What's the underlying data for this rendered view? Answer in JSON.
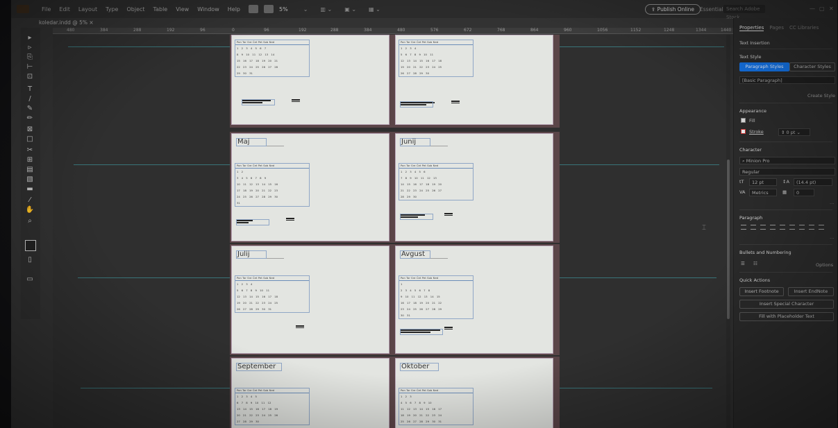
{
  "menubar": {
    "items": [
      "File",
      "Edit",
      "Layout",
      "Type",
      "Object",
      "Table",
      "View",
      "Window",
      "Help"
    ],
    "zoom": "5%",
    "publish_label": "Publish Online",
    "workspace": "Essentials",
    "search_placeholder": "Search Adobe Stock"
  },
  "document": {
    "tab_label": "koledar.indd @ 5%"
  },
  "ruler": {
    "ticks": [
      "480",
      "384",
      "288",
      "192",
      "96",
      "0",
      "96",
      "192",
      "288",
      "384",
      "480",
      "576",
      "672",
      "768",
      "864",
      "960",
      "1056",
      "1152",
      "1248",
      "1344",
      "1440"
    ]
  },
  "calendar": {
    "weekday_header": "Pon Tor Sre Čet Pet Sob Ned",
    "spreads": [
      {
        "left": {
          "month": "",
          "rows": [
            "1 2 3 4 5 6 7",
            "8 9 10 11 12 13 14",
            "15 16 17 18 19 20 21",
            "22 23 24 25 26 27 28",
            "29 30 31"
          ]
        },
        "right": {
          "month": "",
          "rows": [
            "1 2 3 4",
            "5 6 7 8 9 10 11",
            "12 13 14 15 16 17 18",
            "19 20 21 22 23 24 25",
            "26 27 28 29 30"
          ]
        }
      },
      {
        "left": {
          "month": "Maj",
          "rows": [
            "1 2",
            "3 4 5 6 7 8 9",
            "10 11 12 13 14 15 16",
            "17 18 19 20 21 22 23",
            "24 25 26 27 28 29 30",
            "31"
          ]
        },
        "right": {
          "month": "Junij",
          "rows": [
            "1 2 3 4 5 6",
            "7 8 9 10 11 12 13",
            "14 15 16 17 18 19 20",
            "21 22 23 24 25 26 27",
            "28 29 30"
          ]
        }
      },
      {
        "left": {
          "month": "Julij",
          "rows": [
            "1 2 3 4",
            "5 6 7 8 9 10 11",
            "12 13 14 15 16 17 18",
            "19 20 21 22 23 24 25",
            "26 27 28 29 30 31"
          ]
        },
        "right": {
          "month": "Avgust",
          "rows": [
            "1",
            "2 3 4 5 6 7 8",
            "9 10 11 12 13 14 15",
            "16 17 18 19 20 21 22",
            "23 24 25 26 27 28 29",
            "30 31"
          ]
        }
      },
      {
        "left": {
          "month": "September",
          "rows": [
            "1 2 3 4 5",
            "6 7 8 9 10 11 12",
            "13 14 15 16 17 18 19",
            "20 21 22 23 24 25 26",
            "27 28 29 30"
          ]
        },
        "right": {
          "month": "Oktober",
          "rows": [
            "1 2 3",
            "4 5 6 7 8 9 10",
            "11 12 13 14 15 16 17",
            "18 19 20 21 22 23 24",
            "25 26 27 28 29 30 31"
          ]
        }
      }
    ]
  },
  "panel": {
    "tabs": [
      "Properties",
      "Pages",
      "CC Libraries"
    ],
    "text_insertion": "Text Insertion",
    "text_style": {
      "heading": "Text Style",
      "paragraph_styles": "Paragraph Styles",
      "character_styles": "Character Styles",
      "style_value": "[Basic Paragraph]",
      "create_style": "Create Style"
    },
    "appearance": {
      "heading": "Appearance",
      "fill": "Fill",
      "stroke": "Stroke",
      "stroke_weight": "0 pt"
    },
    "character": {
      "heading": "Character",
      "font": "Minion Pro",
      "style": "Regular",
      "size": "12 pt",
      "leading": "(14.4 pt)",
      "kerning": "Metrics",
      "tracking": "0"
    },
    "paragraph": {
      "heading": "Paragraph"
    },
    "bullets": {
      "heading": "Bullets and Numbering",
      "options": "Options"
    },
    "quick_actions": {
      "heading": "Quick Actions",
      "insert_footnote": "Insert Footnote",
      "insert_endnote": "Insert EndNote",
      "insert_special": "Insert Special Character",
      "fill_placeholder": "Fill with Placeholder Text"
    }
  }
}
